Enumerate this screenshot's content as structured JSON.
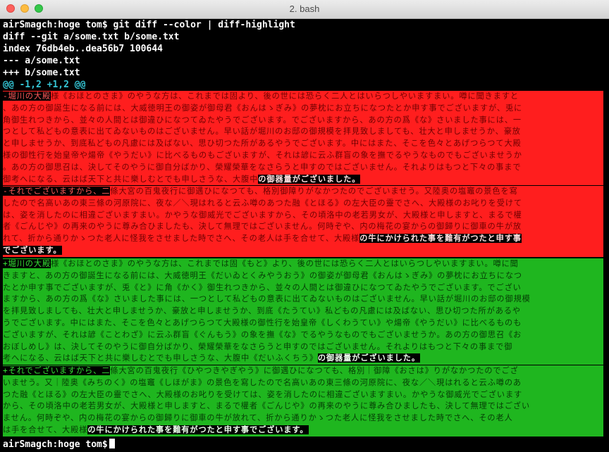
{
  "window": {
    "title": "2. bash",
    "colors": {
      "deleted_bg": "#ff1e1e",
      "added_bg": "#1fb61f",
      "hunk": "#35c6d6"
    }
  },
  "terminal": {
    "command_line": "airSmagch:hoge tom$ git diff --color | diff-highlight",
    "header": [
      "diff --git a/some.txt b/some.txt",
      "index 76db4eb..dea56b7 100644",
      "--- a/some.txt",
      "+++ b/some.txt"
    ],
    "hunk": "@@ -1,2 +1,2 @@",
    "del1": [
      {
        "hl": "-堀川の大殿",
        "t": "様《おほとのさま》のやうな方は、これまでは固より、後の世には恐らく二人とはいらつしやいますまい。噂に聞きますと"
      },
      {
        "t": "、あの方の御誕生になる前には、大威徳明王の御姿が御母君《おんはゝぎみ》の夢枕にお立ちになつたとか申す事でございますが、兎に"
      },
      {
        "t": "角御生れつきから、並々の人間とは御違ひになつてゐたやうでございます。でございますから、あの方の爲《な》さいました事には、一"
      },
      {
        "t": "つとして私どもの意表に出てゐないものはございません。早い話が堀川のお邸の御規模を拝見致しましても、壮大と申しませうか、豪放"
      },
      {
        "t": "と申しませうか、到底私どもの凡慮には及ばない、思ひ切つた所があるやうでございます。中にはまた、そこを色々とあげつらつて大殿"
      },
      {
        "t": "様の御性行を始皇帝や煬帝《やうだい》に比べるものもございますが、それは諺に云ふ群盲の象を撫でるやうなものでもございませうか"
      },
      {
        "t": "。あの方の御思召は、決してそのやうに御自分ばかり、榮耀榮華をなさらうと申すのではございません。それよりはもつと下々の事まで"
      },
      {
        "t": "御考へになる、云はば天下と共に樂しむとでも申しさうな、大腹中",
        "hl2": "の御器量がございました。"
      }
    ],
    "del2": [
      {
        "hl": "-それでございますから、二",
        "t": "條大宮の百鬼夜行に御遇ひになつても、格別御障りがなかつたのでございませう。又陸奥の塩竈の景色を寫"
      },
      {
        "t": "したので名高いあの東三條の河原院に、夜な／＼現はれると云ふ噂のあつた融《とほる》の左大臣の靈でさへ、大殿様のお叱りを受けて"
      },
      {
        "t": "は、姿を消したのに相違ございますまい。かやうな御威光でございますから、その頃洛中の老若男女が、大殿様と申しますと、まるで權"
      },
      {
        "t": "者《ごんじや》の再来のやうに尊み合ひましたも、決して無理ではございません。何時ぞや、内の梅花の宴からの御歸りに御車の牛が放"
      },
      {
        "t": "れて、折から通りかゝつた老人に怪我をさせました時でさへ、その老人は手を合せて、大殿様",
        "hl2": "の牛にかけられた事を難有がつたと申す事"
      },
      {
        "hl2": "でございます。"
      }
    ],
    "add1": [
      {
        "hl": "+堀川の大殿",
        "t": "様《おほとのさま》のやうな方は、これまでは固《もと》より、後の世には恐らく二人とはいらつしやいますまい。噂に聞"
      },
      {
        "t": "きますと、あの方の御誕生になる前には、大威徳明王《だいゐとくみやうおう》の御姿が御母君《おんはゝぎみ》の夢枕にお立ちになつ"
      },
      {
        "t": "たとか申す事でございますが、兎《と》に角《かく》御生れつきから、並々の人間とは御違ひになつてゐたやうでございます。でござい"
      },
      {
        "t": "ますから、あの方の爲《な》さいました事には、一つとして私どもの意表に出てゐないものはございません。早い話が堀川のお邸の御規模"
      },
      {
        "t": "を拝見致しましても、壮大と申しませうか、豪放と申しませうか、到底《たうてい》私どもの凡慮には及ばない、思ひ切つた所があるや"
      },
      {
        "t": "うでございます。中にはまた、そこを色々とあげつらつて大殿様の御性行を始皇帝《しくわうてい》や煬帝《やうだい》に比べるものも"
      },
      {
        "t": "ございますが、それは諺《ことわざ》に云ふ群盲《ぐんもう》の象を撫《な》でるやうなものでもございませうか。あの方の御思召《お"
      },
      {
        "t": "おぼしめし》は、決してそのやうに御自分ばかり、榮耀榮華をなさらうと申すのではございません。それよりはもつと下々の事まで御"
      },
      {
        "t": "考へになる、云はば天下と共に樂しむとでも申しさうな、大腹中《だいふくちう》",
        "hl2": "の御器量がございました。"
      }
    ],
    "add2": [
      {
        "hl": "+それでございますから、二",
        "t": "條大宮の百鬼夜行《ひやつきやぎやう》に御遇ひになつても、格別｜御障《おさは》りがなかつたのでござ"
      },
      {
        "t": "いませう。又｜陸奥《みちのく》の塩竈《しほがま》の景色を寫したので名高いあの東三條の河原院に、夜な／＼現はれると云ふ噂のあ"
      },
      {
        "t": "つた融《とほる》の左大臣の靈でさへ、大殿様のお叱りを受けては、姿を消したのに相違ございますまい。かやうな御威光でございます"
      },
      {
        "t": "から、その頃洛中の老若男女が、大殿様と申しますと、まるで權者《ごんじや》の再来のやうに尊み合ひましたも、決して無理ではござい"
      },
      {
        "t": "ません。何時ぞや、内の梅花の宴からの御歸りに御車の牛が放れて、折から通りかゝつた老人に怪我をさせました時でさへ、その老人"
      },
      {
        "t": "は手を合せて、大殿様",
        "hl2": "の牛にかけられた事を難有がつたと申す事でございます。"
      }
    ],
    "prompt": "airSmagch:hoge tom$"
  }
}
